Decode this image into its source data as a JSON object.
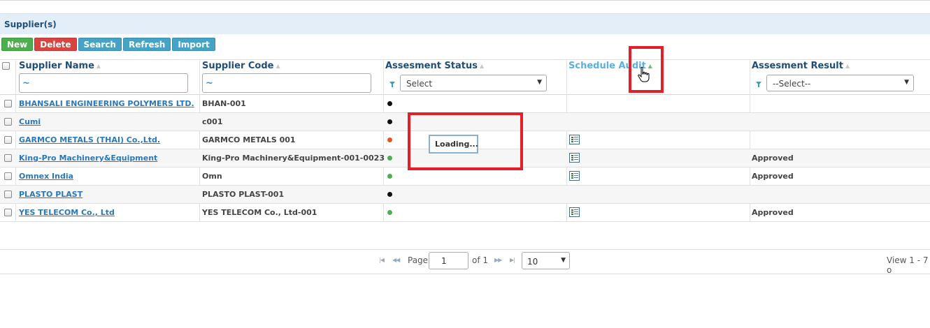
{
  "grid": {
    "caption": "Supplier(s)",
    "toolbar": {
      "new_label": "New",
      "delete_label": "Delete",
      "search_label": "Search",
      "refresh_label": "Refresh",
      "import_label": "Import"
    },
    "columns": {
      "supplier_name": "Supplier Name",
      "supplier_code": "Supplier Code",
      "assessment_status": "Assesment Status",
      "schedule_audit": "Schedule Audit",
      "assessment_result": "Assesment Result"
    },
    "filters": {
      "supplier_name_value": "~",
      "supplier_code_value": "~",
      "status_select": "Select",
      "result_select": "--Select--"
    },
    "rows": [
      {
        "name": "BHANSALI ENGINEERING POLYMERS LTD.",
        "code": "BHAN-001",
        "status_color": "#111111",
        "audit_icon": false,
        "result": ""
      },
      {
        "name": "Cumi",
        "code": "c001",
        "status_color": "#111111",
        "audit_icon": false,
        "result": ""
      },
      {
        "name": "GARMCO METALS (THAI) Co.,Ltd.",
        "code": "GARMCO METALS 001",
        "status_color": "#e8541e",
        "audit_icon": true,
        "result": ""
      },
      {
        "name": "King-Pro Machinery&Equipment",
        "code": "King-Pro Machinery&Equipment-001-0023",
        "status_color": "#4cb050",
        "audit_icon": true,
        "result": "Approved"
      },
      {
        "name": "Omnex India",
        "code": "Omn",
        "status_color": "#4cb050",
        "audit_icon": true,
        "result": "Approved"
      },
      {
        "name": "PLASTO PLAST",
        "code": "PLASTO PLAST-001",
        "status_color": "#111111",
        "audit_icon": false,
        "result": ""
      },
      {
        "name": "YES TELECOM Co., Ltd",
        "code": "YES TELECOM Co., Ltd-001",
        "status_color": "#4cb050",
        "audit_icon": true,
        "result": "Approved"
      }
    ],
    "loading_text": "Loading...",
    "pager": {
      "page_label": "Page",
      "page_value": "1",
      "of_label": "of 1",
      "page_size": "10",
      "view_text": "View 1 - 7 o"
    }
  }
}
